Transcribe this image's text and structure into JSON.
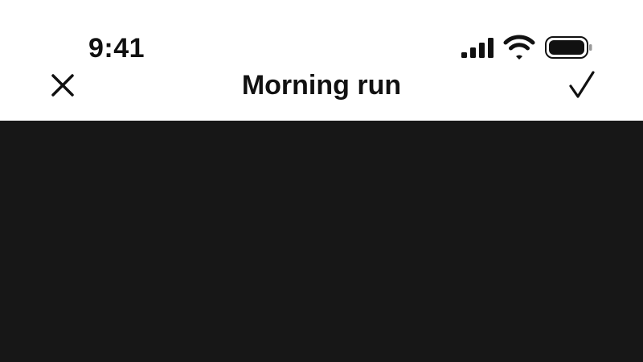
{
  "status_bar": {
    "time": "9:41",
    "icons": [
      "cellular-signal-icon",
      "wifi-icon",
      "battery-icon"
    ]
  },
  "nav_bar": {
    "title": "Morning run",
    "left_icon": "close-icon",
    "right_icon": "checkmark-icon"
  },
  "colors": {
    "header_background": "#ffffff",
    "text": "#111111",
    "content_background": "#171717"
  }
}
